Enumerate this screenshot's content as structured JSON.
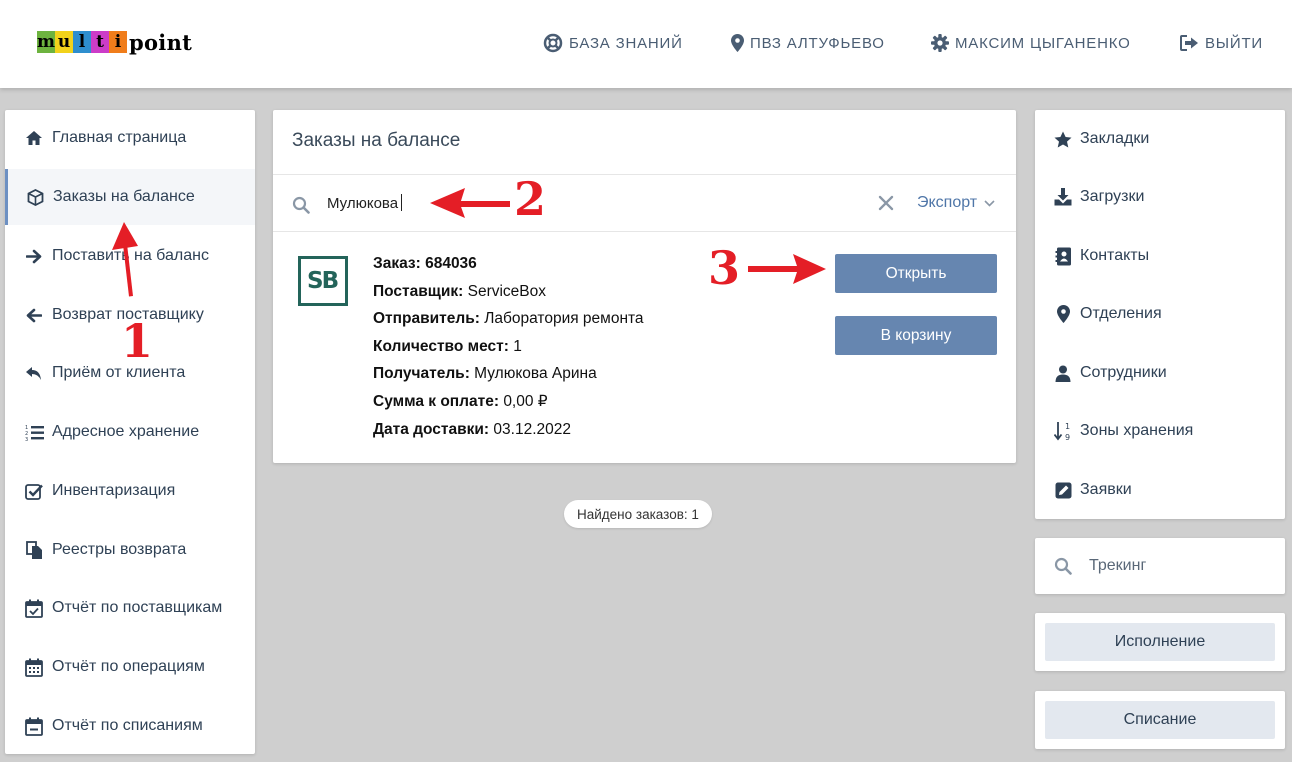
{
  "header": {
    "logo_letters": [
      "m",
      "u",
      "l",
      "t",
      "i"
    ],
    "logo_letter_colors": [
      "#6db33f",
      "#f2d21b",
      "#2e8ece",
      "#cc3cc8",
      "#f07d1b"
    ],
    "logo_rest": "point",
    "nav": [
      {
        "label": "БАЗА ЗНАНИЙ",
        "icon": "lifebuoy-icon"
      },
      {
        "label": "ПВЗ АЛТУФЬЕВО",
        "icon": "map-marker-icon"
      },
      {
        "label": "МАКСИМ ЦЫГАНЕНКО",
        "icon": "gear-icon"
      },
      {
        "label": "ВЫЙТИ",
        "icon": "sign-out-icon"
      }
    ]
  },
  "sidebar": {
    "items": [
      {
        "label": "Главная страница",
        "icon": "home-icon"
      },
      {
        "label": "Заказы на балансе",
        "icon": "cube-icon",
        "active": true
      },
      {
        "label": "Поставить на баланс",
        "icon": "arrow-right-icon"
      },
      {
        "label": "Возврат поставщику",
        "icon": "arrow-left-icon"
      },
      {
        "label": "Приём от клиента",
        "icon": "reply-icon"
      },
      {
        "label": "Адресное хранение",
        "icon": "ordered-list-icon"
      },
      {
        "label": "Инвентаризация",
        "icon": "checkbox-icon"
      },
      {
        "label": "Реестры возврата",
        "icon": "documents-icon"
      },
      {
        "label": "Отчёт по поставщикам",
        "icon": "calendar-check-icon"
      },
      {
        "label": "Отчёт по операциям",
        "icon": "calendar-icon"
      },
      {
        "label": "Отчёт по списаниям",
        "icon": "calendar-minus-icon"
      }
    ]
  },
  "main": {
    "title": "Заказы на балансе",
    "search": {
      "value": "Мулюкова",
      "icon": "search-icon"
    },
    "clear_icon": "close-icon",
    "export_label": "Экспорт",
    "order": {
      "logo_text": "SB",
      "fields": [
        {
          "label": "Заказ:",
          "value": "684036"
        },
        {
          "label": "Поставщик:",
          "value": "ServiceBox"
        },
        {
          "label": "Отправитель:",
          "value": "Лаборатория ремонта"
        },
        {
          "label": "Количество мест:",
          "value": "1"
        },
        {
          "label": "Получатель:",
          "value": "Мулюкова Арина"
        },
        {
          "label": "Сумма к оплате:",
          "value": "0,00 ₽"
        },
        {
          "label": "Дата доставки:",
          "value": "03.12.2022"
        }
      ],
      "open_label": "Открыть",
      "cart_label": "В корзину"
    },
    "found_text": "Найдено заказов: 1"
  },
  "right": {
    "items": [
      {
        "label": "Закладки",
        "icon": "star-icon"
      },
      {
        "label": "Загрузки",
        "icon": "download-icon"
      },
      {
        "label": "Контакты",
        "icon": "address-book-icon"
      },
      {
        "label": "Отделения",
        "icon": "map-marker-icon"
      },
      {
        "label": "Сотрудники",
        "icon": "user-icon"
      },
      {
        "label": "Зоны хранения",
        "icon": "sort-numeric-icon"
      },
      {
        "label": "Заявки",
        "icon": "edit-icon"
      }
    ],
    "tracking_placeholder": "Трекинг",
    "execution_label": "Исполнение",
    "writeoff_label": "Списание"
  },
  "annotations": {
    "step1": "1",
    "step2": "2",
    "step3": "3",
    "color": "#e41e26"
  }
}
